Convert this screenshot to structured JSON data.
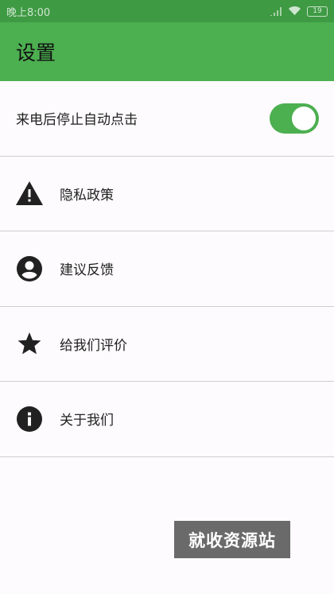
{
  "statusbar": {
    "time": "晚上8:00",
    "battery": "19"
  },
  "appbar": {
    "title": "设置"
  },
  "settings": {
    "toggle_label": "来电后停止自动点击",
    "toggle_on": true,
    "items": [
      {
        "label": "隐私政策",
        "icon": "warning-icon"
      },
      {
        "label": "建议反馈",
        "icon": "account-circle-icon"
      },
      {
        "label": "给我们评价",
        "icon": "star-icon"
      },
      {
        "label": "关于我们",
        "icon": "info-icon"
      }
    ]
  },
  "watermark": "就收资源站",
  "colors": {
    "statusbar": "#3f9a44",
    "accent": "#4caf50",
    "icon": "#212121"
  }
}
